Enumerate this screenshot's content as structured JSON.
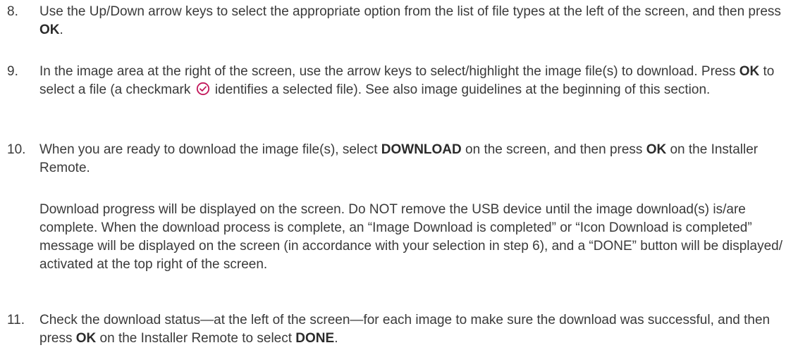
{
  "steps": {
    "s8": {
      "num": "8.",
      "t1": "Use the Up/Down arrow keys to select the appropriate option from the list of file types at the left of the screen, and then press ",
      "b1": "OK",
      "t2": "."
    },
    "s9": {
      "num": "9.",
      "t1": "In the image area at the right of the screen, use the arrow keys to select/highlight the image file(s) to download. Press ",
      "b1": "OK",
      "t2": " to select a file (a checkmark ",
      "icon": "checkmark-circle-icon",
      "t3": " identifies a selected file). See also image guidelines at the beginning of this section."
    },
    "s10": {
      "num": "10.",
      "t1": "When you are ready to download the image file(s), select ",
      "b1": "DOWNLOAD",
      "t2": " on the screen, and then press ",
      "b2": "OK",
      "t3": " on the Installer Remote.",
      "p2": "Download progress will be displayed on the screen. Do NOT remove the USB device until the image download(s) is/are complete. When the download process is complete, an “Image Download is completed” or “Icon Download is completed” message will be displayed on the screen (in accordance with your selection in step 6), and a “DONE” button will be displayed/ activated at the top right of the screen."
    },
    "s11": {
      "num": "11.",
      "t1": "Check the download status—at the left of the screen—for each image to make sure the download was successful, and then press ",
      "b1": "OK",
      "t2": " on the Installer Remote to select ",
      "b2": "DONE",
      "t3": "."
    }
  },
  "colors": {
    "text": "#3a3a3a",
    "checkmark": "#c2185b"
  }
}
